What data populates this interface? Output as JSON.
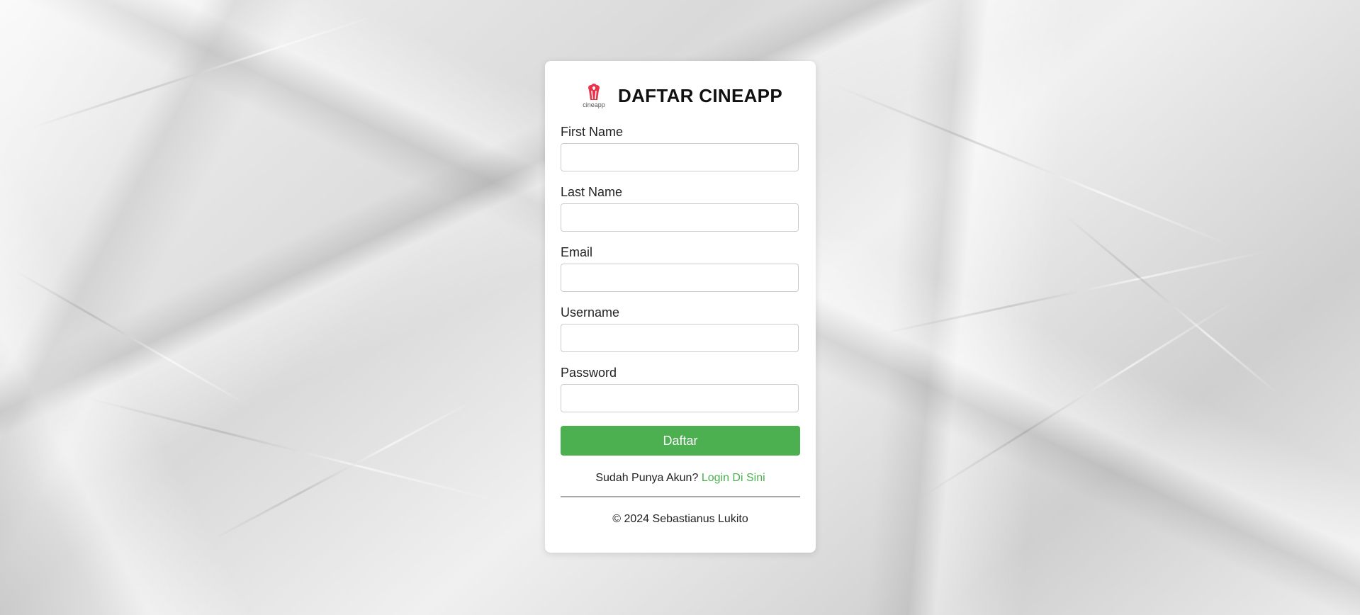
{
  "app": {
    "title": "DAFTAR CINEAPP",
    "logo_text": "cineapp",
    "accent_color": "#4caf50",
    "logo_color": "#e8334a"
  },
  "form": {
    "fields": [
      {
        "label": "First Name",
        "value": ""
      },
      {
        "label": "Last Name",
        "value": ""
      },
      {
        "label": "Email",
        "value": ""
      },
      {
        "label": "Username",
        "value": ""
      },
      {
        "label": "Password",
        "value": ""
      }
    ],
    "submit_label": "Daftar"
  },
  "login_prompt": {
    "text": "Sudah Punya Akun?",
    "link_label": "Login Di Sini"
  },
  "footer": {
    "copyright": "© 2024 Sebastianus Lukito"
  }
}
